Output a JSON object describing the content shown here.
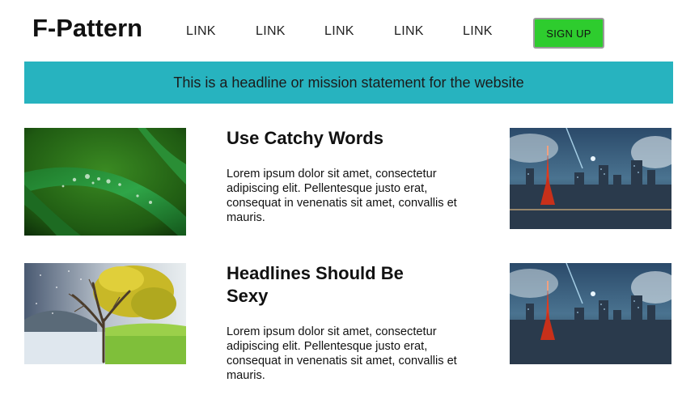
{
  "header": {
    "logo": "F-Pattern",
    "nav": [
      "LINK",
      "LINK",
      "LINK",
      "LINK",
      "LINK"
    ],
    "signup_label": "SIGN UP"
  },
  "banner": {
    "text": "This is a headline or mission statement for the website"
  },
  "rows": [
    {
      "headline": "Use Catchy Words",
      "body": "Lorem ipsum dolor sit amet, consectetur adipiscing elit. Pellentesque justo erat, consequat in venenatis sit amet, convallis et mauris.",
      "left_image": "grass-dew-image",
      "right_image": "city-night-image"
    },
    {
      "headline": "Headlines Should Be Sexy",
      "body": "Lorem ipsum dolor sit amet, consectetur adipiscing elit. Pellentesque justo erat, consequat in venenatis sit amet, convallis et mauris.",
      "left_image": "tree-seasons-image",
      "right_image": "city-night-image"
    }
  ],
  "colors": {
    "banner_bg": "#27b3bf",
    "signup_bg": "#2ecc2e"
  }
}
